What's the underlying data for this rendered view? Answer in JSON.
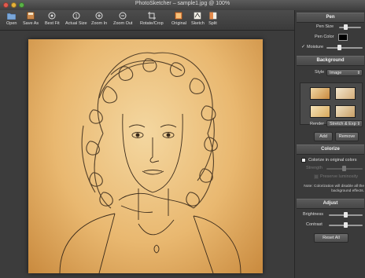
{
  "window": {
    "title": "PhotoSketcher – sample1.jpg @ 100%"
  },
  "toolbar": {
    "items": [
      {
        "label": "Open",
        "icon": "folder-icon"
      },
      {
        "label": "Save As",
        "icon": "save-icon"
      },
      {
        "label": "Best Fit",
        "icon": "best-fit-icon"
      },
      {
        "label": "Actual Size",
        "icon": "actual-size-icon"
      },
      {
        "label": "Zoom In",
        "icon": "zoom-in-icon"
      },
      {
        "label": "Zoom Out",
        "icon": "zoom-out-icon"
      },
      {
        "label": "Rotate/Crop",
        "icon": "rotate-crop-icon"
      },
      {
        "label": "Original",
        "icon": "original-icon"
      },
      {
        "label": "Sketch",
        "icon": "sketch-icon"
      },
      {
        "label": "Split",
        "icon": "split-icon"
      }
    ]
  },
  "panel": {
    "pen": {
      "header": "Pen",
      "pen_size_label": "Pen Size",
      "pen_color_label": "Pen Color",
      "pen_color": "#000000",
      "moisture_label": "Moisture",
      "moisture_checked": true
    },
    "background": {
      "header": "Background",
      "style_label": "Style",
      "style_value": "Image",
      "render_label": "Render",
      "render_value": "Stretch & Exp",
      "add_label": "Add",
      "remove_label": "Remove"
    },
    "colorize": {
      "header": "Colorize",
      "checkbox_label": "Colorize in original colors",
      "strength_label": "Strength",
      "preserve_label": "Preserve luminosity",
      "note": "Note: Colorization will disable all the background effects."
    },
    "adjust": {
      "header": "Adjust",
      "brightness_label": "Brightness",
      "contrast_label": "Contrast",
      "reset_label": "Reset All"
    }
  },
  "colors": {
    "accent_paper": "#e9b870",
    "panel_bg": "#3a3a3a"
  }
}
